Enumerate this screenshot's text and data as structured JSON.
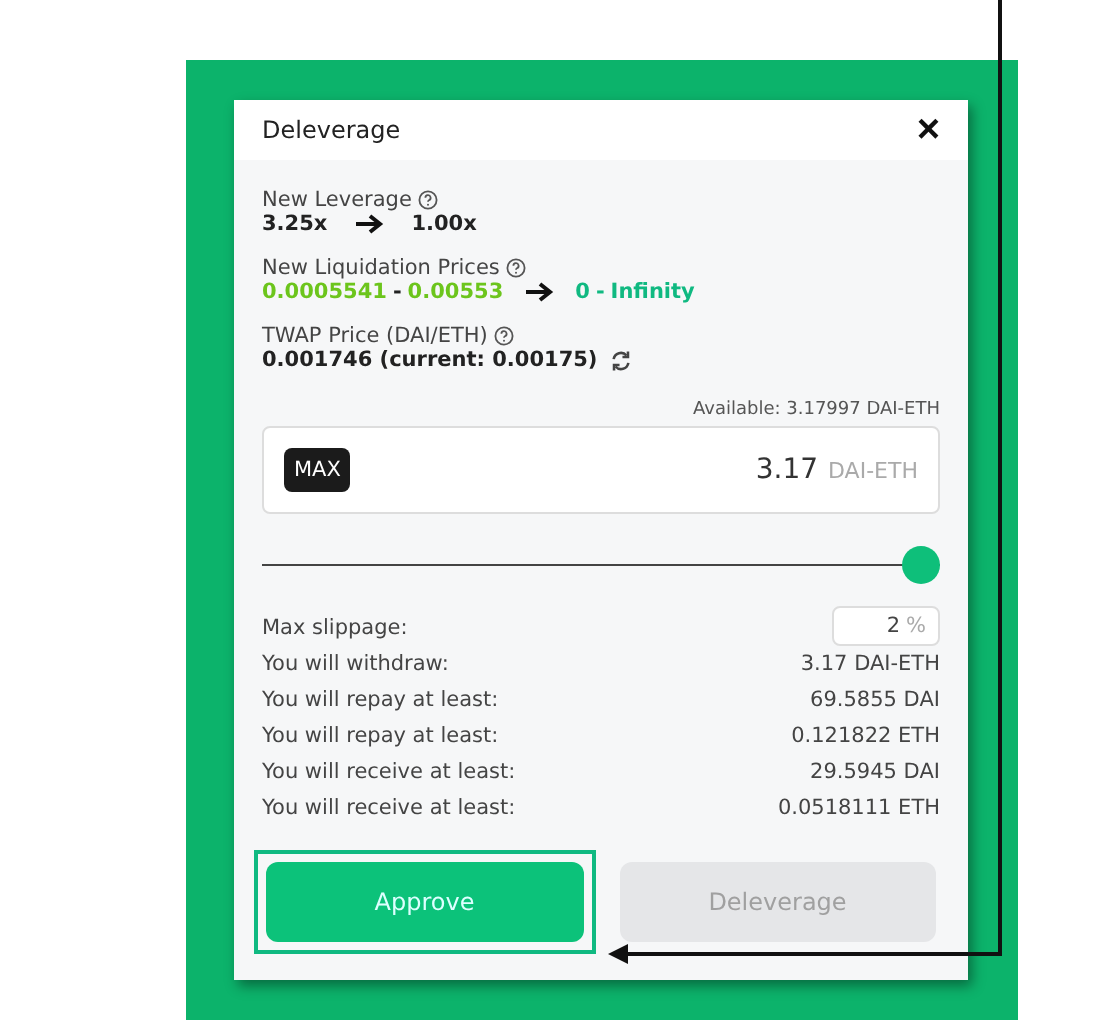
{
  "dialog": {
    "title": "Deleverage",
    "close": "×"
  },
  "leverage": {
    "label": "New Leverage",
    "from": "3.25x",
    "to": "1.00x"
  },
  "liquidation": {
    "label": "New Liquidation Prices",
    "from_low": "0.0005541",
    "from_high": "0.00553",
    "to_low": "0",
    "to_high": "Infinity",
    "separator": "-"
  },
  "twap": {
    "label": "TWAP Price (DAI/ETH)",
    "value": "0.001746 (current: 0.00175)"
  },
  "amount": {
    "available": "Available: 3.17997 DAI-ETH",
    "max": "MAX",
    "value": "3.17",
    "unit": "DAI-ETH"
  },
  "slider": {
    "level": 1
  },
  "slippage": {
    "label": "Max slippage:",
    "value": "2",
    "unit": "%"
  },
  "summary": [
    {
      "label": "You will withdraw:",
      "value": "3.17 DAI-ETH"
    },
    {
      "label": "You will repay at least:",
      "value": "69.5855 DAI"
    },
    {
      "label": "You will repay at least:",
      "value": "0.121822 ETH"
    },
    {
      "label": "You will receive at least:",
      "value": "29.5945 DAI"
    },
    {
      "label": "You will receive at least:",
      "value": "0.0518111 ETH"
    }
  ],
  "buttons": [
    {
      "label": "Approve",
      "disabled": false,
      "highlighted": true
    },
    {
      "label": "Deleverage",
      "disabled": true,
      "highlighted": false
    }
  ]
}
